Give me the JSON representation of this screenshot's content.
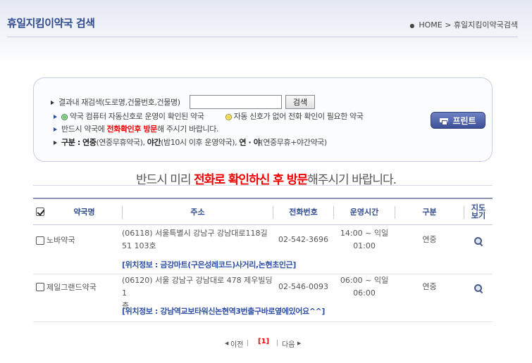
{
  "page": {
    "title": "휴일지킴이약국 검색"
  },
  "breadcrumb": {
    "home": "HOME",
    "sep": ">",
    "current": "휴일지킴이약국검색"
  },
  "search": {
    "label": "결과내 재검색(도로명,건물번호,건물명)",
    "input_value": "",
    "button": "검색",
    "print_button": "프린트",
    "legend_confirmed": "약국 컴퓨터 자동신호로 운영이 확인된 약국",
    "legend_phone": "자동 신호가 없어 전화 확인이 필요한 약국",
    "visit_pre": "반드시 약국에 ",
    "visit_red": "전화확인후 방문",
    "visit_post": "해 주시기 바랍니다.",
    "class_label": "구분 :",
    "class_a_name": "연중",
    "class_a_desc": "(연중무휴약국),",
    "class_b_name": "야간",
    "class_b_desc": "(밤10시 이후 운영약국),",
    "class_c_name": "연 · 야",
    "class_c_desc": "(연중무휴+야간약국)"
  },
  "notice": {
    "pre": "반드시 미리 ",
    "red": "전화로 확인하신 후 방문",
    "post": "해주시기 바랍니다."
  },
  "table": {
    "headers": {
      "name": "약국명",
      "address": "주소",
      "phone": "전화번호",
      "hours": "운영시간",
      "type": "구분",
      "map_l1": "지도",
      "map_l2": "보기"
    },
    "rows": [
      {
        "name": "노바약국",
        "address_l1": "(06118) 서울특별시 강남구 강남대로118길",
        "address_l2": "51 103호",
        "phone": "02-542-3696",
        "hours_l1": "14:00 ~ 익일",
        "hours_l2": "01:00",
        "type": "연중",
        "location": "[위치정보 : 금강마트(구은성레코드)사거리,논현초인근]"
      },
      {
        "name": "제일그랜드약국",
        "address_l1": "(06120) 서울 강남구 강남대로 478 제우빌딩1",
        "address_l2": "층",
        "phone": "02-546-0093",
        "hours_l1": "06:00 ~ 익일",
        "hours_l2": "06:00",
        "type": "연중",
        "location": "[위치정보 : 강남역교보타워신논현역3번출구바로옆에있어요^^]"
      }
    ]
  },
  "pager": {
    "prev": "이전",
    "current": "[1]",
    "next": "다음"
  }
}
